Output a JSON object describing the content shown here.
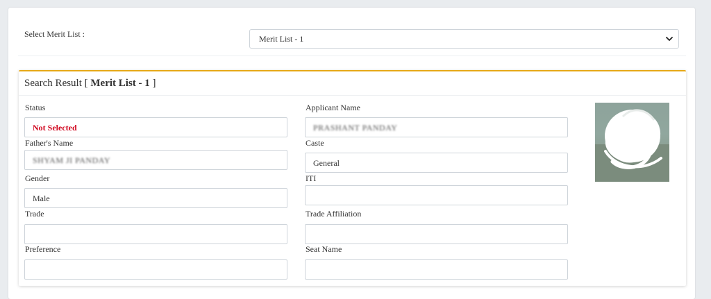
{
  "merit_select": {
    "label": "Select Merit List :",
    "selected": "Merit List - 1"
  },
  "result": {
    "title_prefix": "Search Result [",
    "title_list": "Merit List - 1",
    "title_suffix": "]"
  },
  "fields": {
    "status": {
      "label": "Status",
      "value": "Not Selected"
    },
    "applicant_name": {
      "label": "Applicant Name",
      "value": "PRASHANT PANDAY"
    },
    "fathers_name": {
      "label": "Father's Name",
      "value": "SHYAM JI PANDAY"
    },
    "caste": {
      "label": "Caste",
      "value": "General"
    },
    "gender": {
      "label": "Gender",
      "value": "Male"
    },
    "iti": {
      "label": "ITI",
      "value": ""
    },
    "trade": {
      "label": "Trade",
      "value": ""
    },
    "trade_affiliation": {
      "label": "Trade Affiliation",
      "value": ""
    },
    "preference": {
      "label": "Preference",
      "value": ""
    },
    "seat_name": {
      "label": "Seat Name",
      "value": ""
    }
  },
  "colors": {
    "accent": "#e6a817",
    "status_text": "#d0021b"
  },
  "icons": {
    "dropdown": "chevron-down-icon",
    "photo": "applicant-photo"
  }
}
